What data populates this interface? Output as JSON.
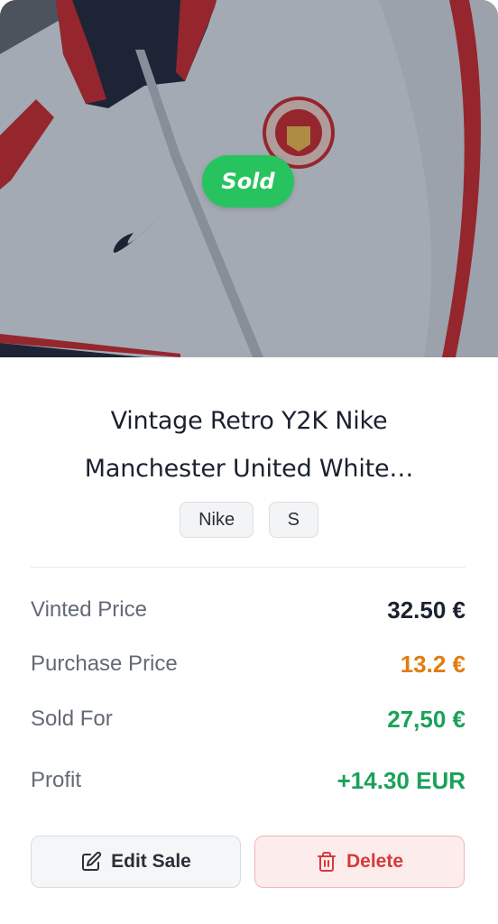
{
  "item": {
    "status_badge": "Sold",
    "title_line1": "Vintage Retro Y2K Nike",
    "title_line2": "Manchester United White…",
    "tags": [
      "Nike",
      "S"
    ]
  },
  "details": {
    "vinted_price": {
      "label": "Vinted Price",
      "value": "32.50 €"
    },
    "purchase_price": {
      "label": "Purchase Price",
      "value": "13.2 €"
    },
    "sold_for": {
      "label": "Sold For",
      "value": "27,50 €"
    },
    "profit": {
      "label": "Profit",
      "value": "+14.30 EUR"
    }
  },
  "actions": {
    "edit_label": "Edit Sale",
    "delete_label": "Delete"
  },
  "colors": {
    "sold_badge": "#27c35f",
    "purchase_price": "#e07d10",
    "sold_for": "#1aa15a",
    "profit": "#1aa15a",
    "price_default": "#1a2230",
    "delete": "#d63a3a"
  },
  "icons": {
    "edit": "pencil-square-icon",
    "delete": "trash-icon"
  }
}
